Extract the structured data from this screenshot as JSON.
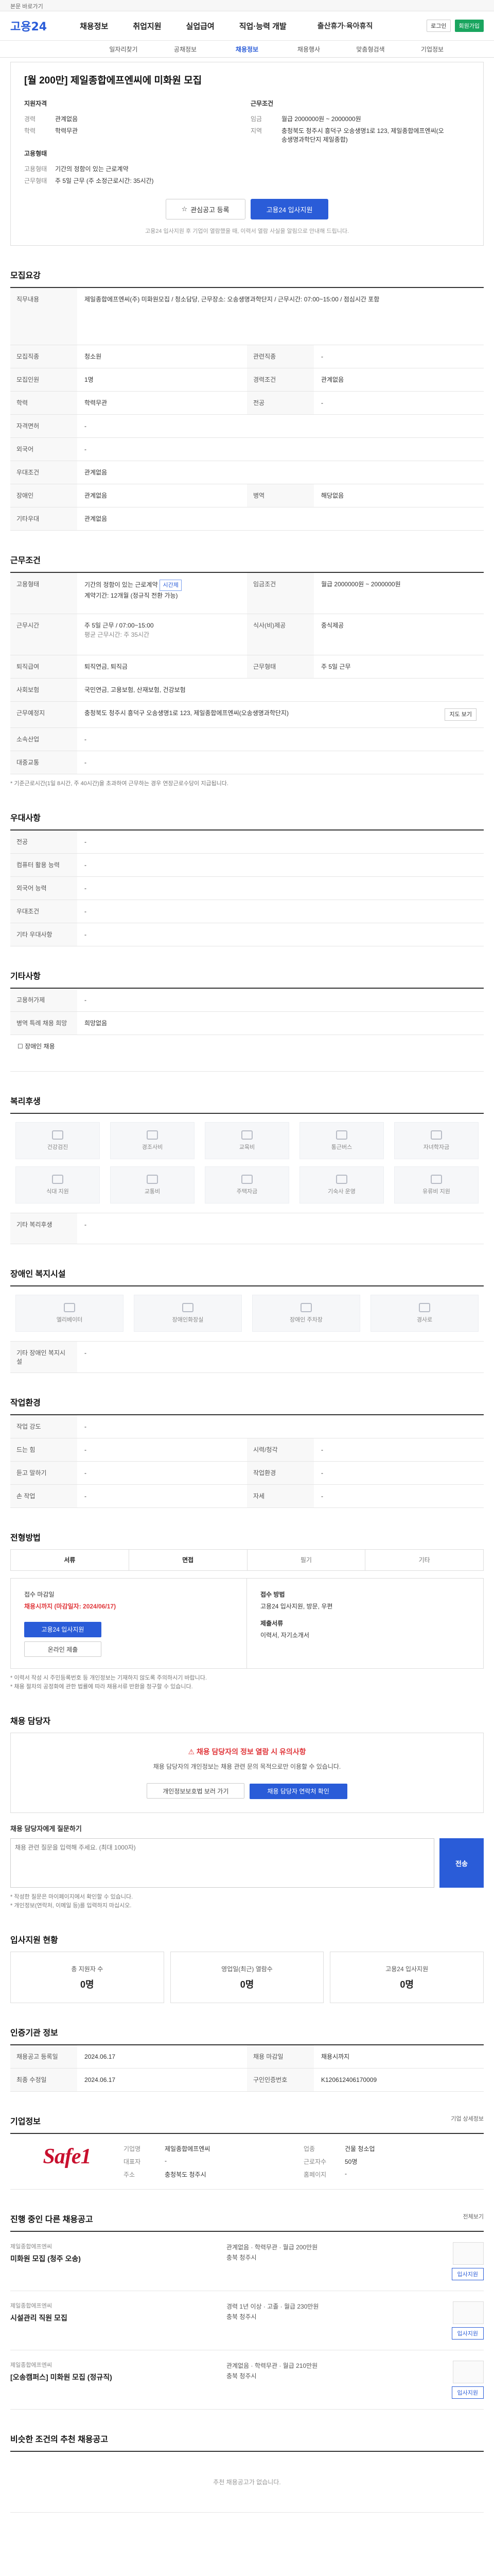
{
  "topbar": {
    "text": "본문 바로가기"
  },
  "header": {
    "logo": "고용24",
    "gnb": [
      "채용정보",
      "취업지원",
      "실업급여",
      "직업·능력 개발"
    ],
    "gnb_extra": "출산휴가·육아휴직",
    "util": [
      "로그인",
      "회원가입"
    ],
    "subnav": [
      "일자리찾기",
      "공채정보",
      "채용정보",
      "채용행사",
      "맞춤형검색",
      "기업정보"
    ]
  },
  "job": {
    "title": "[월 200만] 제일종합에프엔씨에 미화원 모집",
    "cond_head_left": "지원자격",
    "cond_head_right": "근무조건",
    "left": [
      {
        "k": "경력",
        "v": "관계없음"
      },
      {
        "k": "학력",
        "v": "학력무관"
      }
    ],
    "left2_head": "고용형태",
    "left2": [
      {
        "k": "고용형태",
        "v": "기간의 정함이 있는 근로계약"
      },
      {
        "k": "근무형태",
        "v": "주 5일 근무 (주 소정근로시간: 35시간)"
      }
    ],
    "right": [
      {
        "k": "임금",
        "v": "월급 2000000원 ~ 2000000원"
      },
      {
        "k": "지역",
        "v": "충청북도 청주시 흥덕구 오송생명1로 123, 제일종합에프엔씨(오송생명과학단지 제일종합)"
      }
    ],
    "btn_interest": "관심공고 등록",
    "btn_apply": "고용24 입사지원",
    "note": "고용24 입사지원 후 기업이 열람했을 때, 이력서 열람 사실을 알림으로 안내해 드립니다."
  },
  "recruit": {
    "title": "모집요강",
    "duty_label": "직무내용",
    "duty": "제일종합에프엔씨(주) 미화원모집 / 청소담당, 근무장소: 오송생명과학단지 / 근무시간: 07:00~15:00 / 점심시간 포함",
    "rows": [
      {
        "k": "모집직종",
        "v": "청소원",
        "k2": "관련직종",
        "v2": "-"
      },
      {
        "k": "모집인원",
        "v": "1명",
        "k2": "경력조건",
        "v2": "관계없음"
      },
      {
        "k": "학력",
        "v": "학력무관",
        "k2": "전공",
        "v2": "-"
      },
      {
        "k": "자격면허",
        "v": "-",
        "k2": "",
        "v2": ""
      },
      {
        "k": "외국어",
        "v": "-",
        "k2": "",
        "v2": ""
      },
      {
        "k": "우대조건",
        "v": "관계없음",
        "k2": "",
        "v2": ""
      },
      {
        "k": "장애인",
        "v": "관계없음",
        "k2": "병역",
        "v2": "해당없음"
      },
      {
        "k": "기타우대",
        "v": "관계없음",
        "k2": "",
        "v2": ""
      }
    ]
  },
  "work": {
    "title": "근무조건",
    "type_label": "고용형태",
    "type_value": "기간의 정함이 있는 근로계약",
    "type_tag": "시간제",
    "type_sub": "계약기간: 12개월 (정규직 전환 가능)",
    "pay_label": "임금조건",
    "pay_value": "월급 2000000원 ~ 2000000원",
    "hours_label": "근무시간",
    "hours_value": "주 5일 근무 / 07:00~15:00",
    "hours_note": "평균 근무시간: 주 35시간",
    "meal_label": "식사(비)제공",
    "meal_value": "중식제공",
    "rows": [
      {
        "k": "퇴직급여",
        "v": "퇴직연금, 퇴직금",
        "k2": "근무형태",
        "v2": "주 5일 근무"
      },
      {
        "k": "사회보험",
        "v": "국민연금, 고용보험, 산재보험, 건강보험",
        "k2": "",
        "v2": ""
      },
      {
        "k": "근무예정지",
        "v": "충청북도 청주시 흥덕구 오송생명1로 123, 제일종합에프엔씨(오송생명과학단지)",
        "k2": "",
        "v2": ""
      },
      {
        "k": "소속산업",
        "v": "-",
        "k2": "",
        "v2": ""
      },
      {
        "k": "대중교통",
        "v": "-",
        "k2": "",
        "v2": ""
      }
    ],
    "map_btn": "지도 보기",
    "note": "* 기준근로시간(1일 8시간, 주 40시간)을 초과하여 근무하는 경우 연장근로수당이 지급됩니다."
  },
  "prefer": {
    "title": "우대사항",
    "rows": [
      {
        "k": "전공",
        "v": "-"
      },
      {
        "k": "컴퓨터 활용 능력",
        "v": "-"
      },
      {
        "k": "외국어 능력",
        "v": "-"
      },
      {
        "k": "우대조건",
        "v": "-"
      },
      {
        "k": "기타 우대사항",
        "v": "-"
      }
    ]
  },
  "etc": {
    "title": "기타사항",
    "rows": [
      {
        "k": "고용허가제",
        "v": "-"
      },
      {
        "k": "병역 특례 채용 희망",
        "v": "희망없음"
      }
    ],
    "extra": "☐ 장애인 채용"
  },
  "welfare": {
    "title": "복리후생",
    "items": [
      "건강검진",
      "경조사비",
      "교육비",
      "통근버스",
      "자녀학자금",
      "식대 지원",
      "교통비",
      "주택자금",
      "기숙사 운영",
      "유류비 지원"
    ],
    "box_title": "기타 복리후생",
    "box_value": "-"
  },
  "disabled": {
    "title": "장애인 복지시설",
    "items": [
      "엘리베이터",
      "장애인화장실",
      "장애인 주차장",
      "경사로"
    ],
    "box_title": "기타 장애인 복지시설",
    "box_value": "-"
  },
  "workenv": {
    "title": "작업환경",
    "rows": [
      {
        "k": "작업 강도",
        "v": "-",
        "k2": "",
        "v2": ""
      },
      {
        "k": "드는 힘",
        "v": "-",
        "k2": "시력/청각",
        "v2": "-"
      },
      {
        "k": "듣고 말하기",
        "v": "-",
        "k2": "작업환경",
        "v2": "-"
      },
      {
        "k": "손 작업",
        "v": "-",
        "k2": "자세",
        "v2": "-"
      }
    ]
  },
  "method": {
    "title": "전형방법",
    "tabs": [
      "서류",
      "면접",
      "필기",
      "기타"
    ],
    "receive_label": "접수 마감일",
    "receive_value": "채용시까지 (마감일자: 2024/06/17)",
    "btn_apply": "고용24 입사지원",
    "btn_online": "온라인 제출",
    "method_label": "접수 방법",
    "method_value": "고용24 입사지원, 방문, 우편",
    "docs_label": "제출서류",
    "docs_value": "이력서, 자기소개서",
    "notes": [
      "* 이력서 작성 시 주민등록번호 등 개인정보는 기재하지 않도록 주의하시기 바랍니다.",
      "* 채용 절차의 공정화에 관한 법률에 따라 채용서류 반환을 청구할 수 있습니다."
    ]
  },
  "contact": {
    "title": "채용 담당자",
    "warn": "채용 담당자의 정보 열람 시 유의사항",
    "desc": "채용 담당자의 개인정보는 채용 관련 문의 목적으로만 이용할 수 있습니다.",
    "btn_a": "개인정보보호법 보러 가기",
    "btn_b": "채용 담당자 연락처 확인",
    "qa_title": "채용 담당자에게 질문하기",
    "qa_placeholder": "채용 관련 질문을 입력해 주세요. (최대 1000자)",
    "qa_send": "전송",
    "qa_notes": [
      "* 작성한 질문은 마이페이지에서 확인할 수 있습니다.",
      "* 개인정보(연락처, 이메일 등)를 입력하지 마십시오."
    ]
  },
  "stats": {
    "title": "입사지원 현황",
    "items": [
      {
        "label": "총 지원자 수",
        "value": "0명"
      },
      {
        "label": "영업일(최근) 열람수",
        "value": "0명"
      },
      {
        "label": "고용24 입사지원",
        "value": "0명"
      }
    ]
  },
  "info": {
    "title": "인증기관 정보",
    "rows": [
      {
        "k": "채용공고 등록일",
        "v": "2024.06.17",
        "k2": "채용 마감일",
        "v2": "채용시까지"
      },
      {
        "k": "최종 수정일",
        "v": "2024.06.17",
        "k2": "구인인증번호",
        "v2": "K120612406170009"
      }
    ]
  },
  "company": {
    "title": "기업정보",
    "logo_text": "Safe1",
    "more": "기업 상세정보",
    "info": [
      {
        "k": "기업명",
        "v": "제일종합에프엔씨",
        "k2": "업종",
        "v2": "건물 청소업"
      },
      {
        "k": "대표자",
        "v": "-",
        "k2": "근로자수",
        "v2": "50명"
      },
      {
        "k": "주소",
        "v": "충청북도 청주시",
        "k2": "홈페이지",
        "v2": "-"
      }
    ]
  },
  "similar": {
    "title": "진행 중인 다른 채용공고",
    "more": "전체보기",
    "jobs": [
      {
        "co": "제일종합에프엔씨",
        "title": "미화원 모집 (청주 오송)",
        "cond": "관계없음 · 학력무관 · 월급 200만원",
        "area": "충북 청주시",
        "btn": "입사지원"
      },
      {
        "co": "제일종합에프엔씨",
        "title": "시설관리 직원 모집",
        "cond": "경력 1년 이상 · 고졸 · 월급 230만원",
        "area": "충북 청주시",
        "btn": "입사지원"
      },
      {
        "co": "제일종합에프엔씨",
        "title": "[오송캠퍼스] 미화원 모집 (정규직)",
        "cond": "관계없음 · 학력무관 · 월급 210만원",
        "area": "충북 청주시",
        "btn": "입사지원"
      }
    ]
  },
  "similar2": {
    "title": "비슷한 조건의 추천 채용공고",
    "empty": "추천 채용공고가 없습니다."
  }
}
